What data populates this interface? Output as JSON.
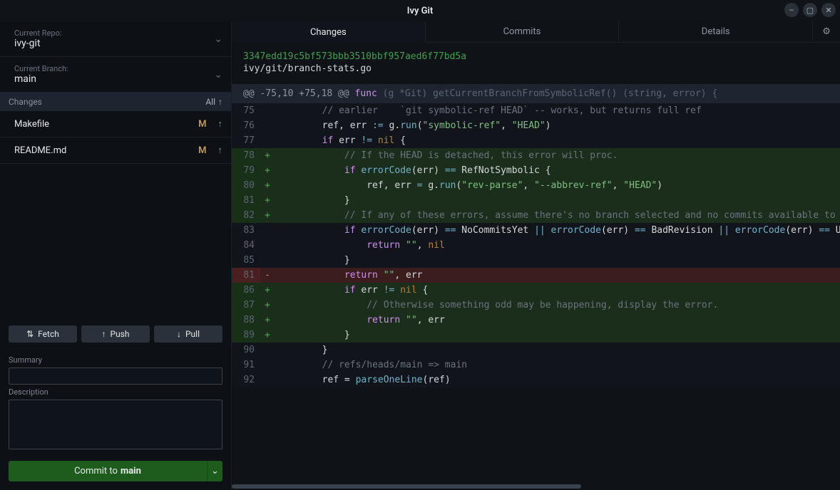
{
  "window": {
    "title": "Ivy Git"
  },
  "sidebar": {
    "repo_label": "Current Repo:",
    "repo_value": "ivy-git",
    "branch_label": "Current Branch:",
    "branch_value": "main",
    "changes_heading": "Changes",
    "changes_all": "All",
    "files": [
      {
        "name": "Makefile",
        "status": "M"
      },
      {
        "name": "README.md",
        "status": "M"
      }
    ],
    "actions": {
      "fetch": "Fetch",
      "push": "Push",
      "pull": "Pull"
    },
    "form": {
      "summary_label": "Summary",
      "summary_value": "",
      "description_label": "Description",
      "description_value": ""
    },
    "commit_btn_prefix": "Commit to ",
    "commit_btn_branch": "main"
  },
  "tabs": {
    "changes": "Changes",
    "commits": "Commits",
    "details": "Details"
  },
  "diff": {
    "hash": "3347edd19c5bf573bbb3510bbf957aed6f77bd5a",
    "file": "ivy/git/branch-stats.go",
    "hunk_at": "@@ -75,10 +75,18 @@ ",
    "hunk_sig_prefix": "func",
    "hunk_sig_rest": " (g *Git) getCurrentBranchFromSymbolicRef() (string, error) {",
    "lines": [
      {
        "n": "75",
        "t": "ctx",
        "html": "        <span class='c'>// earlier    `git symbolic-ref HEAD` -- works, but returns full ref</span>"
      },
      {
        "n": "76",
        "t": "ctx",
        "html": "        <span class='id'>ref, err </span><span class='op'>:=</span><span class='id'> g.</span><span class='f'>run</span><span class='id'>(</span><span class='s'>\"symbolic-ref\"</span><span class='id'>, </span><span class='s'>\"HEAD\"</span><span class='id'>)</span>"
      },
      {
        "n": "77",
        "t": "ctx",
        "html": "        <span class='k'>if</span><span class='id'> err </span><span class='op'>!=</span> <span class='n'>nil</span><span class='id'> {</span>"
      },
      {
        "n": "78",
        "t": "add",
        "html": "            <span class='c'>// If the HEAD is detached, this error will proc.</span>"
      },
      {
        "n": "79",
        "t": "add",
        "html": "            <span class='k'>if</span> <span class='f'>errorCode</span><span class='id'>(err) </span><span class='op'>==</span><span class='id'> RefNotSymbolic {</span>"
      },
      {
        "n": "80",
        "t": "add",
        "html": "                <span class='id'>ref, err </span><span class='op'>=</span><span class='id'> g.</span><span class='f'>run</span><span class='id'>(</span><span class='s'>\"rev-parse\"</span><span class='id'>, </span><span class='s'>\"--abbrev-ref\"</span><span class='id'>, </span><span class='s'>\"HEAD\"</span><span class='id'>)</span>"
      },
      {
        "n": "81",
        "t": "add",
        "html": "            <span class='id'>}</span>"
      },
      {
        "n": "82",
        "t": "add",
        "html": "            <span class='c'>// If any of these errors, assume there's no branch selected and no commits available to p</span>"
      },
      {
        "n": "83",
        "t": "ctx",
        "html": "            <span class='k'>if</span> <span class='f'>errorCode</span><span class='id'>(err) </span><span class='op'>==</span><span class='id'> NoCommitsYet </span><span class='op'>||</span> <span class='f'>errorCode</span><span class='id'>(err) </span><span class='op'>==</span><span class='id'> BadRevision </span><span class='op'>||</span> <span class='f'>errorCode</span><span class='id'>(err) </span><span class='op'>==</span><span class='id'> Un</span>"
      },
      {
        "n": "84",
        "t": "ctx",
        "html": "                <span class='k'>return</span> <span class='s'>\"\"</span><span class='id'>, </span><span class='n'>nil</span>"
      },
      {
        "n": "85",
        "t": "ctx",
        "html": "            <span class='id'>}</span>"
      },
      {
        "n": "81",
        "t": "del",
        "html": "            <span class='k'>return</span> <span class='s'>\"\"</span><span class='id'>, err</span>"
      },
      {
        "n": "86",
        "t": "add",
        "html": "            <span class='k'>if</span><span class='id'> err </span><span class='op'>!=</span> <span class='n'>nil</span><span class='id'> {</span>"
      },
      {
        "n": "87",
        "t": "add",
        "html": "                <span class='c'>// Otherwise something odd may be happening, display the error.</span>"
      },
      {
        "n": "88",
        "t": "add",
        "html": "                <span class='k'>return</span> <span class='s'>\"\"</span><span class='id'>, err</span>"
      },
      {
        "n": "89",
        "t": "add",
        "html": "            <span class='id'>}</span>"
      },
      {
        "n": "90",
        "t": "ctx",
        "html": "        <span class='id'>}</span>"
      },
      {
        "n": "91",
        "t": "ctx",
        "html": "        <span class='c'>// refs/heads/main =&gt; main</span>"
      },
      {
        "n": "92",
        "t": "ctx",
        "html": "        <span class='id'>ref = </span><span class='f'>parseOneLine</span><span class='id'>(ref)</span>"
      }
    ]
  }
}
